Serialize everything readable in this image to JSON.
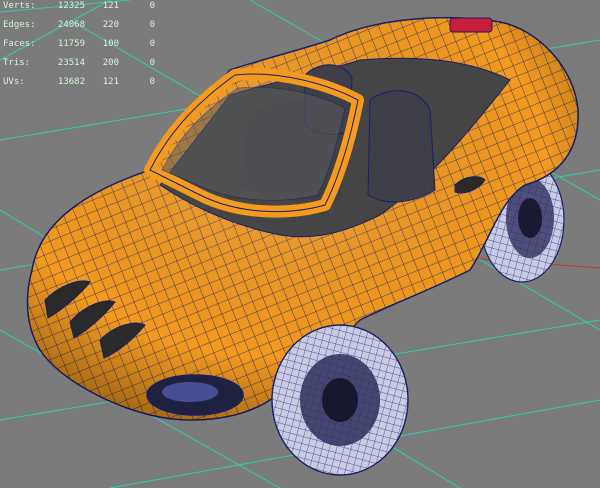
{
  "stats": {
    "rows": [
      {
        "label": "Verts:",
        "total": "12325",
        "selected": "121",
        "extra": "0"
      },
      {
        "label": "Edges:",
        "total": "24068",
        "selected": "220",
        "extra": "0"
      },
      {
        "label": "Faces:",
        "total": "11759",
        "selected": "100",
        "extra": "0"
      },
      {
        "label": "Tris:",
        "total": "23514",
        "selected": "200",
        "extra": "0"
      },
      {
        "label": "UVs:",
        "total": "13682",
        "selected": "121",
        "extra": "0"
      }
    ]
  },
  "colors": {
    "background": "#7b7b7b",
    "grid": "#2fd0a8",
    "body": "#f39a1f",
    "wire": "#1b1f66",
    "tire": "#c9cbe0",
    "interior": "#4a4a4a",
    "axis_x": "#c0392b"
  },
  "scene": {
    "object": "toy-convertible-car",
    "mode": "wireframe-on-shaded"
  }
}
